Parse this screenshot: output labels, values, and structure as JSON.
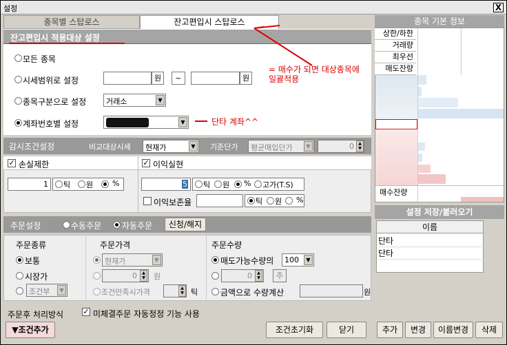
{
  "window": {
    "title": "설정",
    "close": "X"
  },
  "tabs": [
    "종목별 스탑로스",
    "잔고편입시 스탑로스"
  ],
  "header": {
    "title": "잔고편입시 적용대상 설정"
  },
  "target": {
    "all": "모든 종목",
    "price_range": "시세범위로 설정",
    "won1": "원",
    "tilde": "~",
    "won2": "원",
    "category": "종목구분으로 설정",
    "category_value": "거래소",
    "account": "계좌번호별 설정"
  },
  "annotations": {
    "note": "= 매수가 되면 대상종목에 일괄적용",
    "danta": "단타 계좌^^"
  },
  "watch": {
    "title": "감시조건설정",
    "compare_label": "비교대상시세",
    "compare_value": "현재가",
    "base_label": "기준단가",
    "base_value": "평균매입단가",
    "base_num": "0"
  },
  "loss": {
    "label": "손실제한",
    "value": "1",
    "tick": "틱",
    "won": "원",
    "pct": "%"
  },
  "profit": {
    "label": "이익실현",
    "value": "5",
    "tick": "틱",
    "won": "원",
    "pct": "%",
    "high": "고가(T.S)",
    "preserve": "이익보존율",
    "tick2": "틱",
    "won2": "원",
    "pct2": "%"
  },
  "order": {
    "title": "주문설정",
    "manual": "수동주문",
    "auto": "자동주문",
    "apply_btn": "신청/해지",
    "type_title": "주문종류",
    "normal": "보통",
    "market": "시장가",
    "cond": "조건부",
    "price_title": "주문가격",
    "price_value": "현재가",
    "price_num": "0",
    "won": "원",
    "cond_price": "조건만족시가격",
    "tick": "틱",
    "qty_title": "주문수량",
    "max_qty": "매도가능수량의",
    "max_pct": "100",
    "qty_num": "0",
    "ju": "주",
    "amount": "금액으로 수량계산",
    "won2": "원"
  },
  "after": {
    "label": "주문후 처리방식",
    "auto_correct": "미체결주문 자동정정 기능 사용"
  },
  "buttons": {
    "add_cond": "▼조건추가",
    "reset": "조건초기화",
    "close": "닫기"
  },
  "side": {
    "title": "종목 기본 정보",
    "rows": [
      "상한/하한",
      "거래량",
      "최우선",
      "매도잔량"
    ],
    "bottom": "매수잔량",
    "save_title": "설정 저장/불러오기",
    "name_header": "이름",
    "names": [
      "단타",
      "단타"
    ],
    "add": "추가",
    "change": "변경",
    "rename": "이름변경",
    "delete": "삭제"
  }
}
